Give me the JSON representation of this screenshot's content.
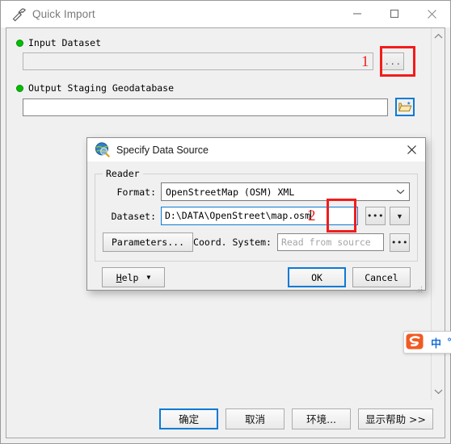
{
  "window": {
    "title": "Quick Import",
    "icon": "hammer-tool-icon",
    "controls": {
      "minimize": "—",
      "maximize": "□",
      "close": "✕"
    }
  },
  "parameters": [
    {
      "label": "Input Dataset",
      "status_icon": "green-dot-required",
      "value": "",
      "button": "...",
      "annotation": "1"
    },
    {
      "label": "Output Staging Geodatabase",
      "status_icon": "green-dot-required",
      "value": "",
      "button": "open-folder-icon"
    }
  ],
  "scrollbar": {
    "up_arrow": "chevron-up-icon",
    "down_arrow": "chevron-down-icon"
  },
  "bottom_bar": {
    "buttons": [
      {
        "label": "确定",
        "primary": true
      },
      {
        "label": "取消",
        "primary": false
      },
      {
        "label": "环境...",
        "primary": false
      },
      {
        "label": "显示帮助 >>",
        "primary": false,
        "wide": true
      }
    ]
  },
  "dialog": {
    "title": "Specify Data Source",
    "icon": "globe-magnifier-icon",
    "close": "✕",
    "group": {
      "legend": "Reader",
      "format": {
        "label": "Format:",
        "value": "OpenStreetMap (OSM) XML",
        "arrow": "chevron-down-icon"
      },
      "dataset": {
        "label": "Dataset:",
        "value": "D:\\DATA\\OpenStreet\\map.osm",
        "browse_button": "•••",
        "dropdown_button": "▼",
        "annotation": "2"
      },
      "parameters_button": "Parameters...",
      "coord": {
        "label": "Coord. System:",
        "placeholder": "Read from source",
        "value": "",
        "button": "•••"
      }
    },
    "footer": {
      "help_label_underlined": "H",
      "help_label_rest": "elp",
      "help_arrow": "▼",
      "ok": "OK",
      "cancel": "Cancel"
    }
  },
  "ime": {
    "logo": "sogou-logo-icon",
    "mode": "中",
    "punctuation": "°,"
  },
  "colors": {
    "annotation_red": "#f21c1c",
    "focus_blue": "#0b7ad5",
    "required_green": "#00c000",
    "window_bg": "#f0f0f0"
  }
}
